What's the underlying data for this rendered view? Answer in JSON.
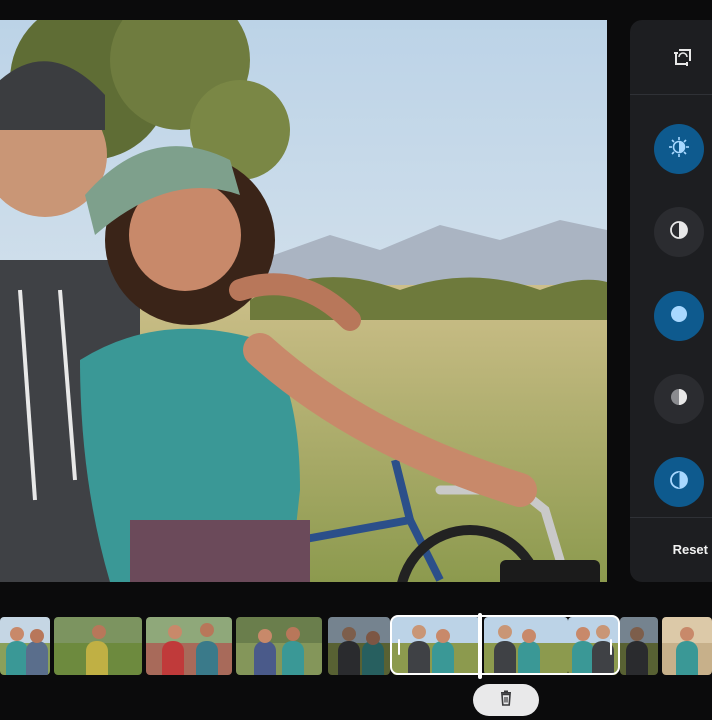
{
  "app": {
    "reset_label": "Reset"
  },
  "icons": {
    "crop_rotate": "crop-rotate-icon",
    "tools": [
      "brightness-icon",
      "contrast-icon",
      "highlight-icon",
      "shadow-icon",
      "saturation-icon"
    ],
    "delete": "trash-icon"
  },
  "tools": [
    {
      "name": "brightness",
      "state": "active"
    },
    {
      "name": "contrast",
      "state": "inactive"
    },
    {
      "name": "highlights",
      "state": "active"
    },
    {
      "name": "shadows",
      "state": "inactive"
    },
    {
      "name": "saturation",
      "state": "active"
    }
  ],
  "colors": {
    "accent": "#0e5a8e",
    "panel": "#1d1e21",
    "background": "#0b0b0c",
    "icon_active": "#a8d8ff"
  },
  "timeline": {
    "thumbnail_count": 11,
    "selected_clip_count": 2
  }
}
